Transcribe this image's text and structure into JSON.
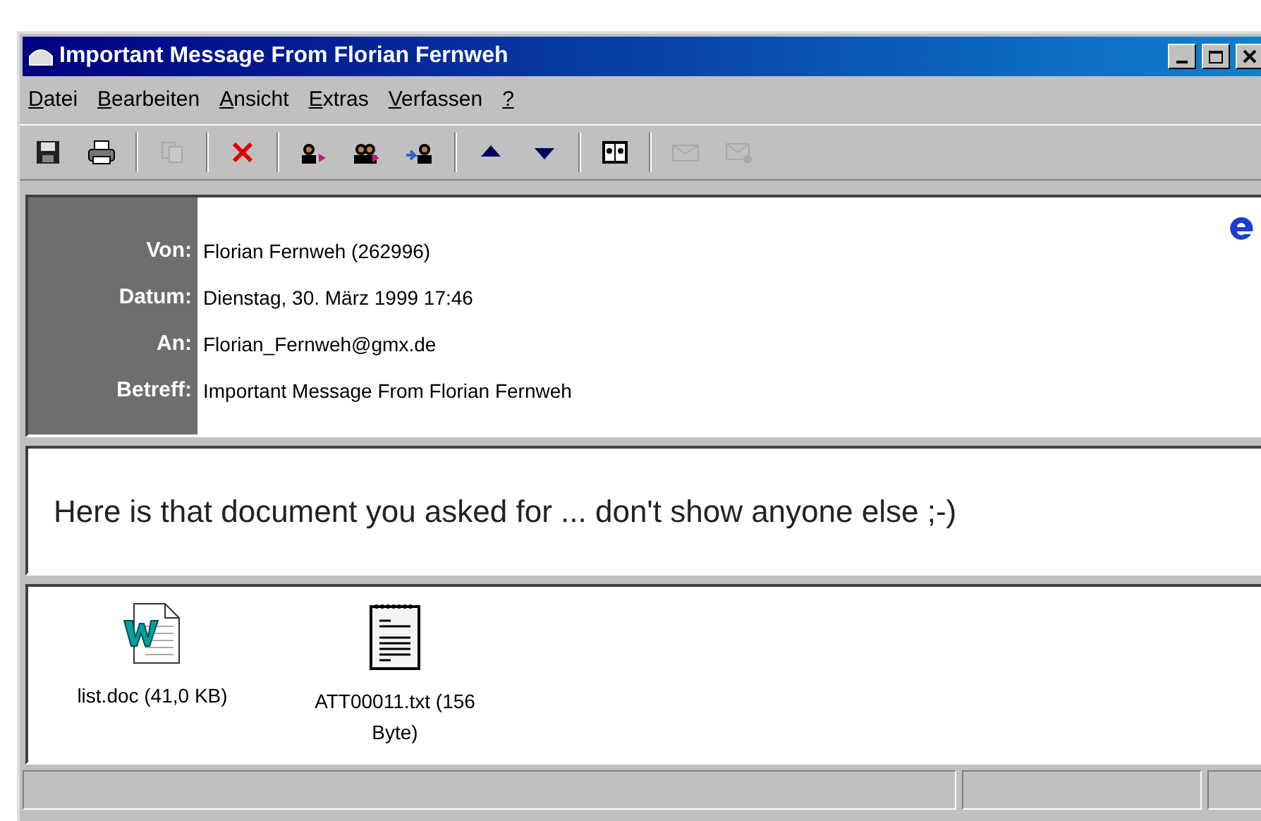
{
  "window": {
    "title": "Important Message From Florian Fernweh"
  },
  "menu": [
    "Datei",
    "Bearbeiten",
    "Ansicht",
    "Extras",
    "Verfassen",
    "?"
  ],
  "toolbar": [
    {
      "kind": "save",
      "disabled": false
    },
    {
      "kind": "print",
      "disabled": false
    },
    {
      "kind": "sep"
    },
    {
      "kind": "copy",
      "disabled": true
    },
    {
      "kind": "sep"
    },
    {
      "kind": "delete",
      "disabled": false
    },
    {
      "kind": "sep"
    },
    {
      "kind": "reply",
      "disabled": false
    },
    {
      "kind": "reply_all",
      "disabled": false
    },
    {
      "kind": "forward",
      "disabled": false
    },
    {
      "kind": "sep"
    },
    {
      "kind": "previous",
      "disabled": false
    },
    {
      "kind": "next",
      "disabled": false
    },
    {
      "kind": "sep"
    },
    {
      "kind": "address_book",
      "disabled": false
    },
    {
      "kind": "sep"
    },
    {
      "kind": "mail",
      "disabled": true
    },
    {
      "kind": "mail_attach",
      "disabled": true
    }
  ],
  "header": [
    {
      "label": "Von:",
      "value": "Florian Fernweh (262996)"
    },
    {
      "label": "Datum:",
      "value": "Dienstag, 30. März 1999 17:46"
    },
    {
      "label": "An:",
      "value": "Florian_Fernweh@gmx.de"
    },
    {
      "label": "Betreff:",
      "value": "Important Message From Florian Fernweh"
    }
  ],
  "message": {
    "body": "Here is that document you asked for ... don't show anyone else ;-)"
  },
  "attachments": [
    {
      "kind": "word",
      "name": "list.doc (41,0 KB)"
    },
    {
      "kind": "text",
      "name": "ATT00011.txt (156 Byte)"
    }
  ]
}
